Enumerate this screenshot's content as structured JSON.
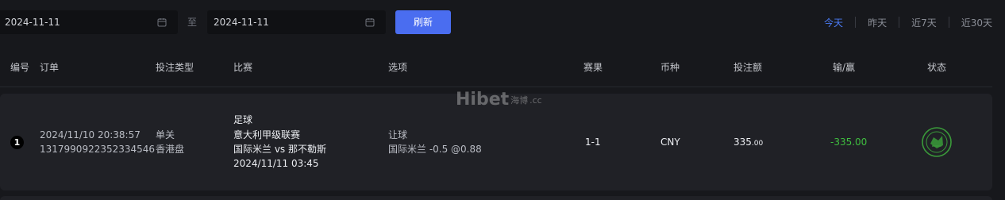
{
  "filters": {
    "start_date": "2024-11-11",
    "separator": "至",
    "end_date": "2024-11-11",
    "refresh_label": "刷新",
    "quick_ranges": [
      "今天",
      "昨天",
      "近7天",
      "近30天"
    ],
    "active_range": "今天"
  },
  "table": {
    "headers": {
      "index": "编号",
      "order": "订单",
      "bet_type": "投注类型",
      "match": "比赛",
      "option": "选项",
      "result": "赛果",
      "currency": "币种",
      "amount": "投注额",
      "win_loss": "输/赢",
      "status": "状态"
    },
    "rows": [
      {
        "index": "1",
        "order_time": "2024/11/10 20:38:57",
        "order_id": "1317990922352334546",
        "bet_type": "单关",
        "odds_type": "香港盘",
        "sport": "足球",
        "league": "意大利甲级联赛",
        "teams": "国际米兰 vs 那不勒斯",
        "match_time": "2024/11/11 03:45",
        "option_type": "让球",
        "option_detail": "国际米兰 -0.5 @0.88",
        "result": "1-1",
        "currency": "CNY",
        "amount_int": "335",
        "amount_dec": ".00",
        "win_loss": "-335.00",
        "status_icon": "lost-stamp-icon"
      }
    ]
  },
  "watermark": {
    "brand": "Hibet",
    "chinese": "海博",
    "suffix": ".cc"
  },
  "colors": {
    "background": "#17181c",
    "card": "#202126",
    "accent": "#4a6df0",
    "active_tab": "#4b7bf5",
    "loss": "#3fbf3f",
    "stamp": "#3a9a3a"
  }
}
